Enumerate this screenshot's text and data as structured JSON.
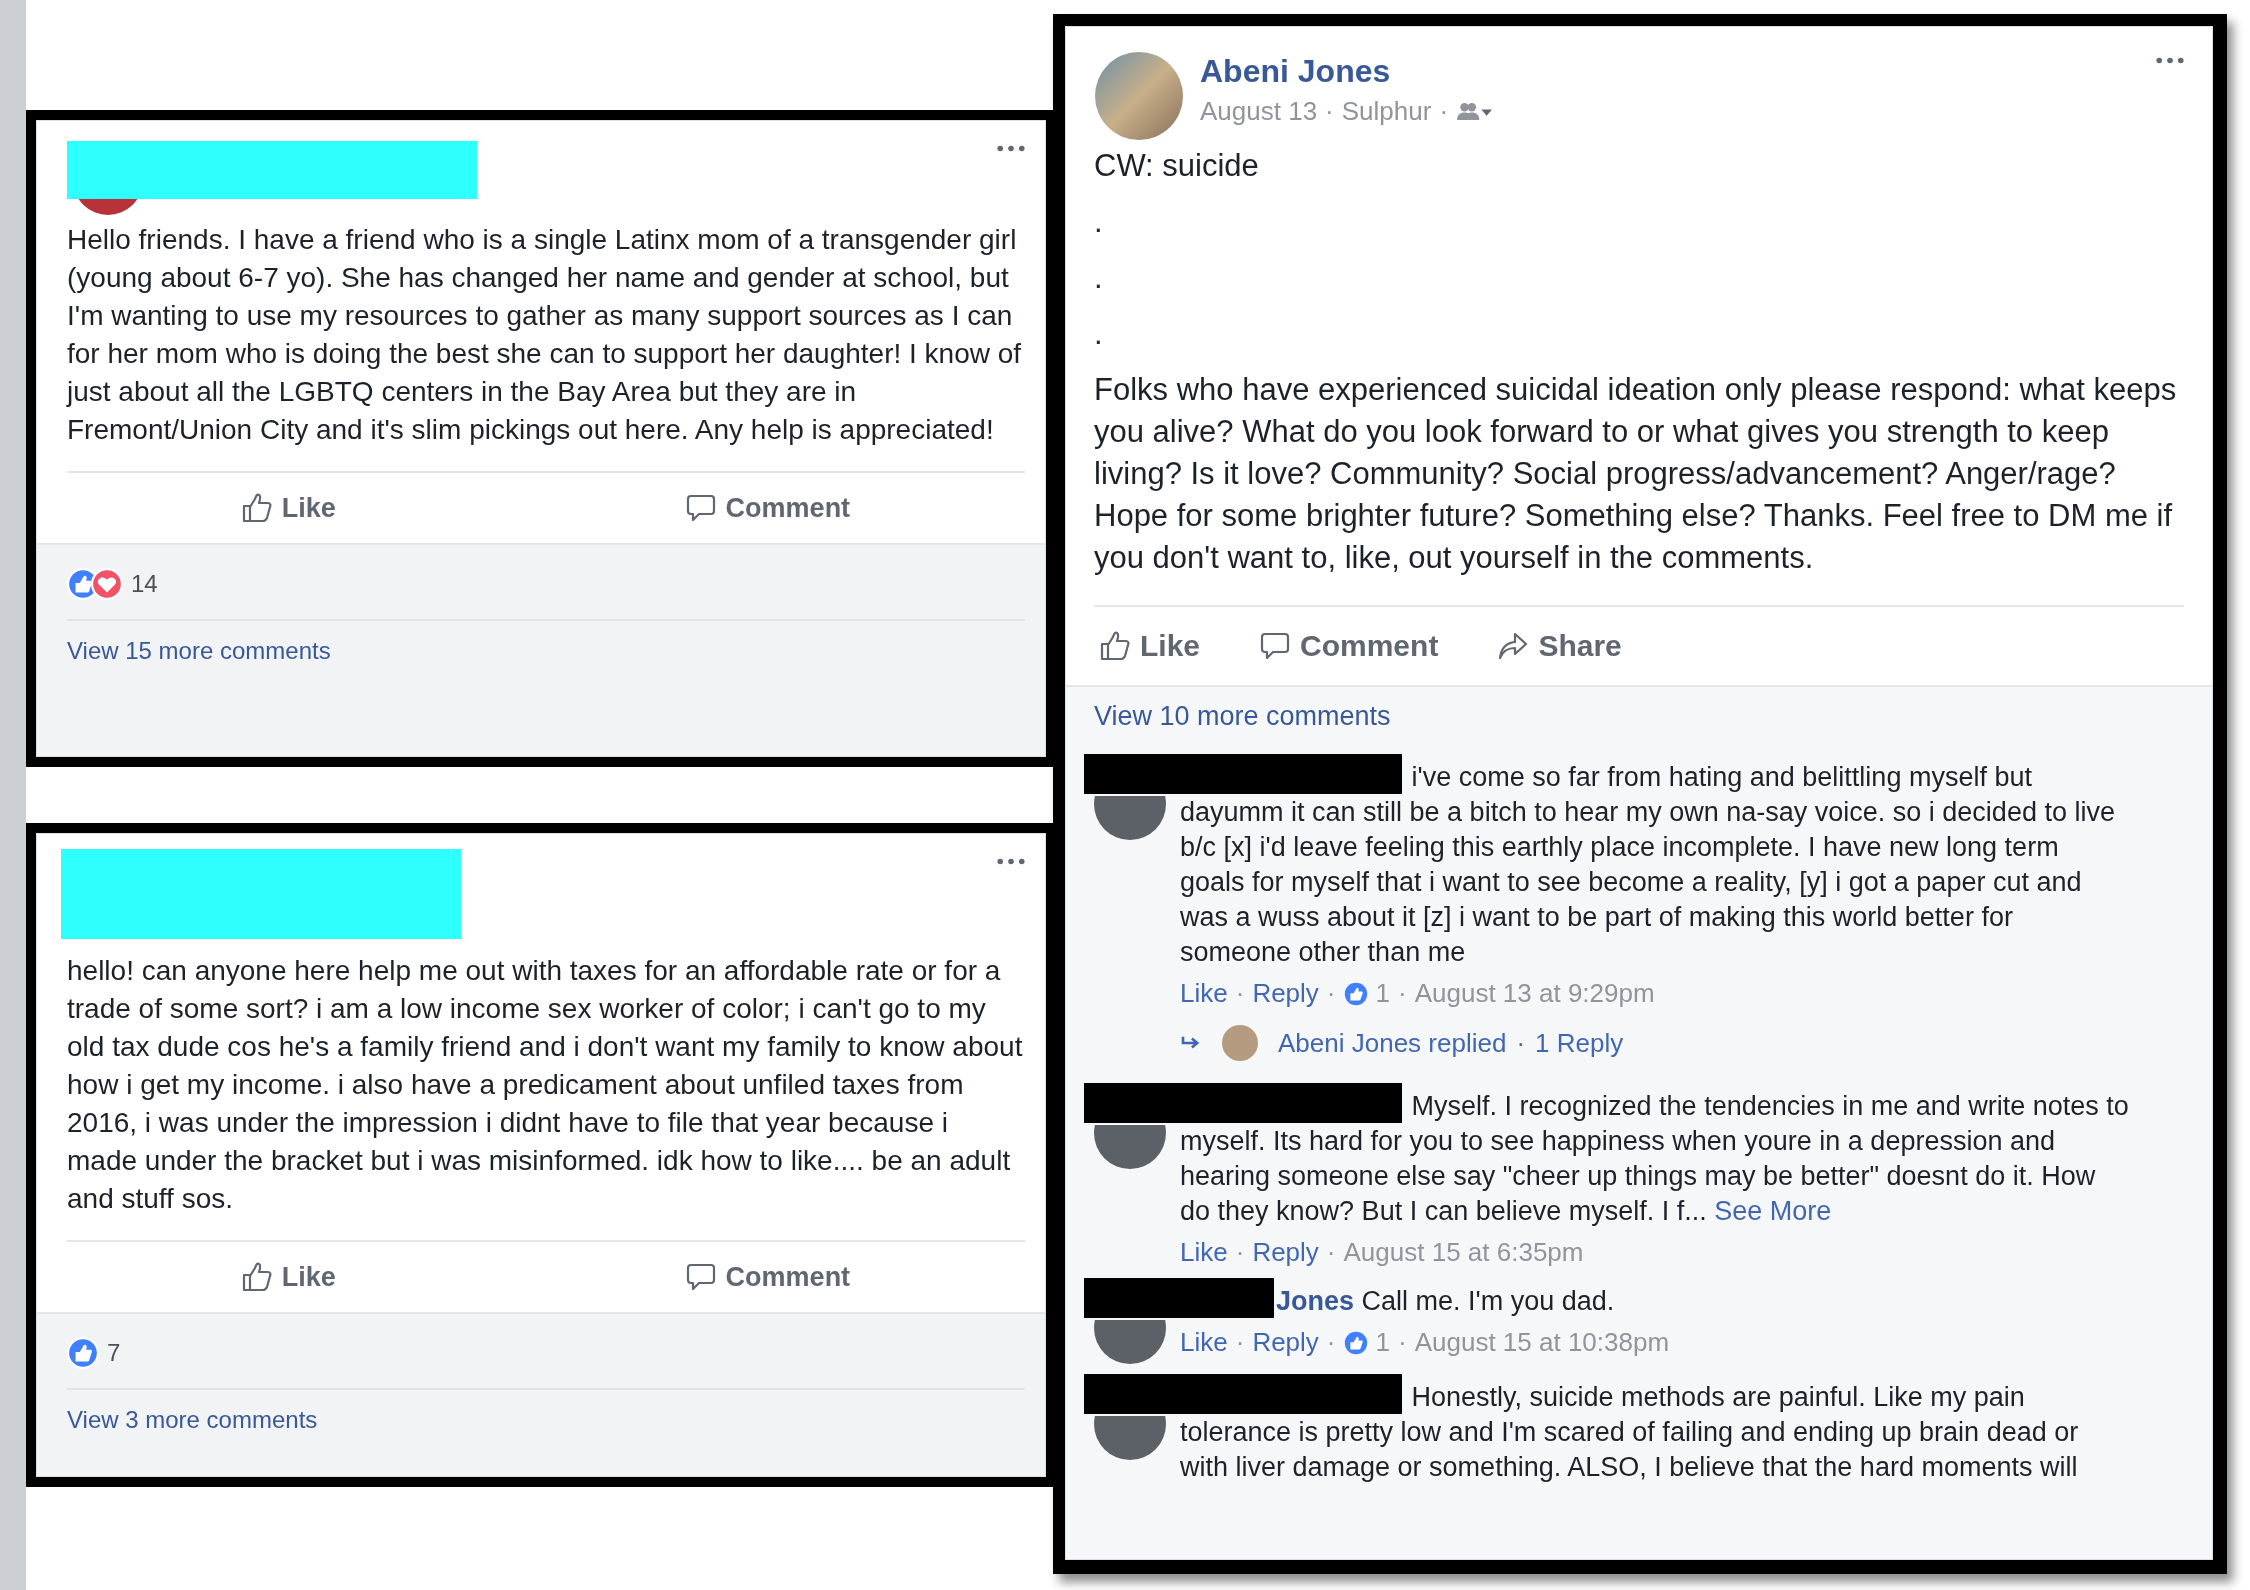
{
  "separator": "·",
  "posts": [
    {
      "avatar": true,
      "body": [
        "Hello friends. I have a friend who is a single Latinx mom of a transgender girl (young about 6-7 yo). She has changed her name and gender at school, but I'm wanting to use my resources to gather as many support sources as I can for her mom who is doing the best she can to support her daughter! I know of just about all the LGBTQ centers in the Bay Area but they are in Fremont/Union City and it's slim pickings out here. Any help is appreciated!"
      ],
      "actions": [
        {
          "kind": "like",
          "label": "Like"
        },
        {
          "kind": "comment",
          "label": "Comment"
        }
      ],
      "reactions": {
        "like": true,
        "love": true,
        "count": "14"
      },
      "more_comments": "View 15 more comments"
    },
    {
      "body": [
        "hello! can anyone here help me out with taxes for an affordable rate or for a trade of some sort? i am a low income sex worker of color; i can't go to my old tax dude cos he's a family friend and i don't want my family to know about how i get my income. i also have a predicament about unfiled taxes from 2016, i was under the impression i didnt have to file that year because i made under the bracket but i was misinformed. idk how to like.... be an adult and stuff sos."
      ],
      "actions": [
        {
          "kind": "like",
          "label": "Like"
        },
        {
          "kind": "comment",
          "label": "Comment"
        }
      ],
      "reactions": {
        "like": true,
        "count": "7"
      },
      "more_comments": "View 3 more comments"
    },
    {
      "author": "Abeni Jones",
      "date": "August 13",
      "place": "Sulphur",
      "body": [
        "CW: suicide",
        ".",
        ".",
        ".",
        "Folks who have experienced suicidal ideation only please respond: what keeps you alive? What do you look forward to or what gives you strength to keep living? Is it love? Community? Social progress/advancement? Anger/rage? Hope for some brighter future? Something else? Thanks. Feel free to DM me if you don't want to, like, out yourself in the comments."
      ],
      "actions": [
        {
          "kind": "like",
          "label": "Like"
        },
        {
          "kind": "comment",
          "label": "Comment"
        },
        {
          "kind": "share",
          "label": "Share"
        }
      ],
      "more_comments": "View 10 more comments",
      "comments": [
        {
          "text": "i've come so far from hating and belittling myself but dayumm it can still be a bitch to hear my own na-say voice. so i decided to live b/c [x] i'd leave feeling this earthly place incomplete. I have new long term goals for myself that i want to see become a reality, [y] i got a paper cut and was a wuss about it [z] i want to be part of making this world better for someone other than me",
          "links": [
            "Like",
            "Reply"
          ],
          "likes": "1",
          "time": "August 13 at 9:29pm",
          "reply": {
            "label": "Abeni Jones replied",
            "count": "1 Reply"
          }
        },
        {
          "text": "Myself. I recognized the tendencies in me and write notes to myself. Its hard for you to see happiness when youre in a depression and hearing someone else say \"cheer up things may be better\" doesnt do it. How do they know? But I can believe myself. I f...",
          "see_more": "See More",
          "links": [
            "Like",
            "Reply"
          ],
          "time": "August 15 at 6:35pm"
        },
        {
          "author": "Jones",
          "text": "Call me. I'm you dad.",
          "links": [
            "Like",
            "Reply"
          ],
          "likes": "1",
          "time": "August 15 at 10:38pm"
        },
        {
          "text": "Honestly, suicide methods are painful. Like my pain tolerance is pretty low and I'm scared of failing and ending up brain dead or with liver damage or something. ALSO, I believe that the hard moments will"
        }
      ]
    }
  ]
}
